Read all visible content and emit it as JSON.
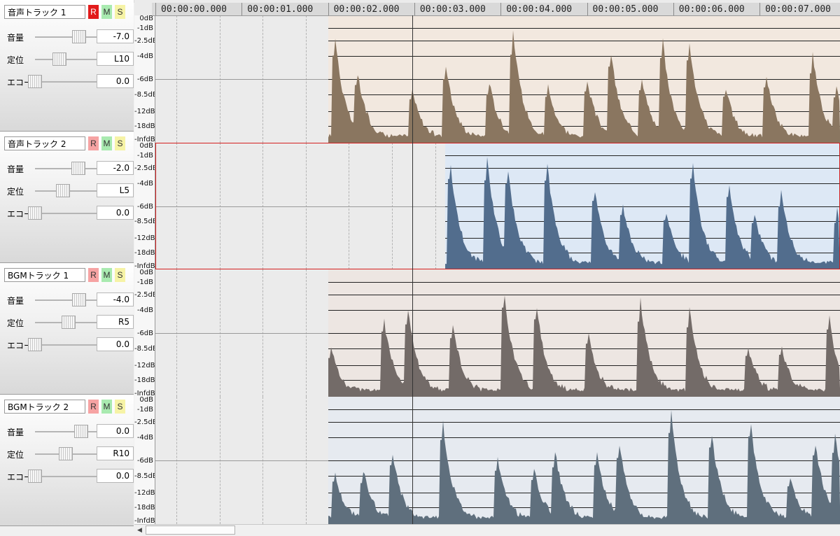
{
  "tracks": [
    {
      "name": "音声トラック 1",
      "rec": true,
      "volume_label": "音量",
      "volume": "-7.0",
      "volume_level": 0.72,
      "pan_label": "定位",
      "pan": "L10",
      "pan_level": 0.4,
      "echo_label": "エコー",
      "echo": "0.0",
      "echo_level": 0.0,
      "r": "R",
      "m": "M",
      "s": "S",
      "clip_color": "#f2e8df",
      "wave_color": "#8a7660",
      "clip_start": 2.0,
      "clip_end": 7.42,
      "selected": false
    },
    {
      "name": "音声トラック 2",
      "rec": false,
      "volume_label": "音量",
      "volume": "-2.0",
      "volume_level": 0.71,
      "pan_label": "定位",
      "pan": "L5",
      "pan_level": 0.45,
      "echo_label": "エコー",
      "echo": "0.0",
      "echo_level": 0.0,
      "r": "R",
      "m": "M",
      "s": "S",
      "clip_color": "#dde8f5",
      "wave_color": "#526d8d",
      "clip_start": 3.36,
      "clip_end": 7.42,
      "selected": true
    },
    {
      "name": "BGMトラック 1",
      "rec": false,
      "volume_label": "音量",
      "volume": "-4.0",
      "volume_level": 0.72,
      "pan_label": "定位",
      "pan": "R5",
      "pan_level": 0.55,
      "echo_label": "エコー",
      "echo": "0.0",
      "echo_level": 0.0,
      "r": "R",
      "m": "M",
      "s": "S",
      "clip_color": "#ede6e2",
      "wave_color": "#736b68",
      "clip_start": 2.0,
      "clip_end": 7.42,
      "selected": false
    },
    {
      "name": "BGMトラック 2",
      "rec": false,
      "volume_label": "音量",
      "volume": "0.0",
      "volume_level": 0.75,
      "pan_label": "定位",
      "pan": "R10",
      "pan_level": 0.5,
      "echo_label": "エコー",
      "echo": "0.0",
      "echo_level": 0.0,
      "r": "R",
      "m": "M",
      "s": "S",
      "clip_color": "#e6eaf0",
      "wave_color": "#5f6f7d",
      "clip_start": 2.0,
      "clip_end": 7.42,
      "selected": false
    }
  ],
  "timeline": {
    "markers": [
      "00:00:00.000",
      "00:00:01.000",
      "00:00:02.000",
      "00:00:03.000",
      "00:00:04.000",
      "00:00:05.000",
      "00:00:06.000",
      "00:00:07.000"
    ],
    "playhead_seconds": 2.98
  },
  "scale_labels": [
    "0dB",
    "-1dB",
    "-2.5dB",
    "-4dB",
    "-6dB",
    "-8.5dB",
    "-12dB",
    "-18dB",
    "-InfdB"
  ]
}
